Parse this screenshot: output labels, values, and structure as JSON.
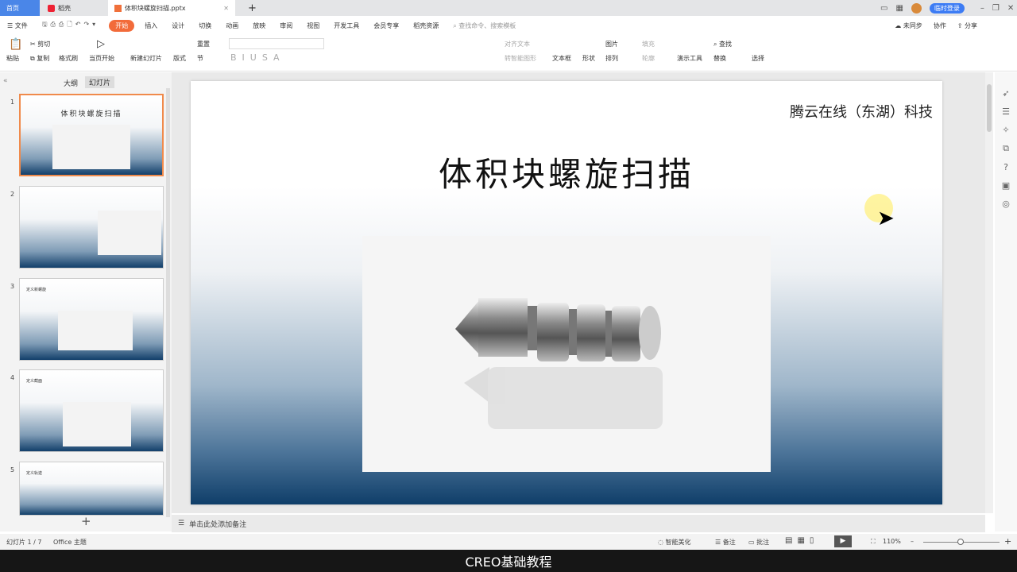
{
  "tabs": [
    {
      "label": "首页"
    },
    {
      "label": "稻壳"
    },
    {
      "label": "体积块螺旋扫描.pptx"
    }
  ],
  "titlebar": {
    "login": "临时登录"
  },
  "menu": {
    "file": "文件",
    "items": [
      "开始",
      "插入",
      "设计",
      "切换",
      "动画",
      "放映",
      "审阅",
      "视图",
      "开发工具",
      "会员专享",
      "稻壳资源"
    ],
    "search": "查找命令、搜索模板",
    "sync": "未同步",
    "collab": "协作",
    "share": "分享"
  },
  "toolbar": {
    "paste": "粘贴",
    "cut": "剪切",
    "copy": "复制",
    "format_painter": "格式刷",
    "play_from": "当页开始",
    "new_slide": "新建幻灯片",
    "layout": "版式",
    "section": "节",
    "reset": "重置",
    "align_text": "对齐文本",
    "smartart": "转智能图形",
    "textbox": "文本框",
    "shape": "形状",
    "picture": "图片",
    "fill": "填充",
    "arrange": "排列",
    "outline": "轮廓",
    "presenter_tools": "演示工具",
    "find": "查找",
    "replace": "替换",
    "select": "选择"
  },
  "leftpanel": {
    "outline_tab": "大纲",
    "slides_tab": "幻灯片",
    "thumbs": [
      {
        "num": "1",
        "title": "体积块螺旋扫描"
      },
      {
        "num": "2"
      },
      {
        "num": "3",
        "title": "定义新螺旋"
      },
      {
        "num": "4",
        "title": "定义截面"
      },
      {
        "num": "5",
        "title": "定义轨迹"
      }
    ]
  },
  "slide": {
    "company": "腾云在线（东湖）科技",
    "title": "体积块螺旋扫描"
  },
  "notes": {
    "placeholder": "单击此处添加备注"
  },
  "status": {
    "slide_counter": "幻灯片 1 / 7",
    "theme": "Office 主题",
    "beautify": "智能美化",
    "notes": "备注",
    "comment": "批注",
    "zoom": "110%"
  },
  "subtitle": "CREO基础教程",
  "colors": {
    "accent": "#f26b3a",
    "slide_bottom": "#0f3e69",
    "login": "#3d7cf4"
  }
}
